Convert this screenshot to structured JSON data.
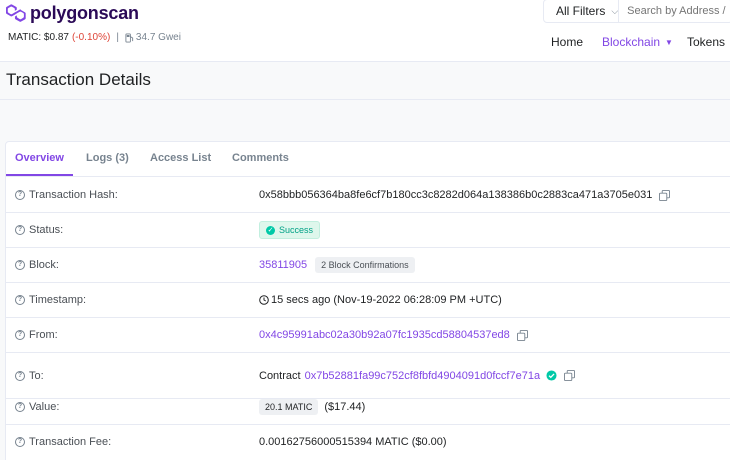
{
  "brand": {
    "name": "polygonscan",
    "color": "#8247e5"
  },
  "ticker": {
    "price_label": "MATIC: $0.87",
    "change": "(-0.10%)",
    "separator": "|",
    "gas": "34.7 Gwei"
  },
  "search": {
    "filter_label": "All Filters",
    "placeholder": "Search by Address /"
  },
  "nav": {
    "home": "Home",
    "blockchain": "Blockchain",
    "tokens": "Tokens"
  },
  "page": {
    "title": "Transaction Details"
  },
  "tabs": [
    {
      "label": "Overview",
      "active": true
    },
    {
      "label": "Logs (3)",
      "active": false
    },
    {
      "label": "Access List",
      "active": false
    },
    {
      "label": "Comments",
      "active": false
    }
  ],
  "details": {
    "hash": {
      "label": "Transaction Hash:",
      "value": "0x58bbb056364ba8fe6cf7b180cc3c8282d064a138386b0c2883ca471a3705e031"
    },
    "status": {
      "label": "Status:",
      "value": "Success"
    },
    "block": {
      "label": "Block:",
      "value": "35811905",
      "confirmations": "2 Block Confirmations"
    },
    "timestamp": {
      "label": "Timestamp:",
      "value": "15 secs ago (Nov-19-2022 06:28:09 PM +UTC)"
    },
    "from": {
      "label": "From:",
      "value": "0x4c95991abc02a30b92a07fc1935cd58804537ed8"
    },
    "to": {
      "label": "To:",
      "prefix": "Contract",
      "value": "0x7b52881fa99c752cf8fbfd4904091d0fccf7e71a"
    },
    "value": {
      "label": "Value:",
      "amount": "20.1 MATIC",
      "usd": "($17.44)"
    },
    "fee": {
      "label": "Transaction Fee:",
      "value": "0.00162756000515394 MATIC ($0.00)"
    }
  }
}
